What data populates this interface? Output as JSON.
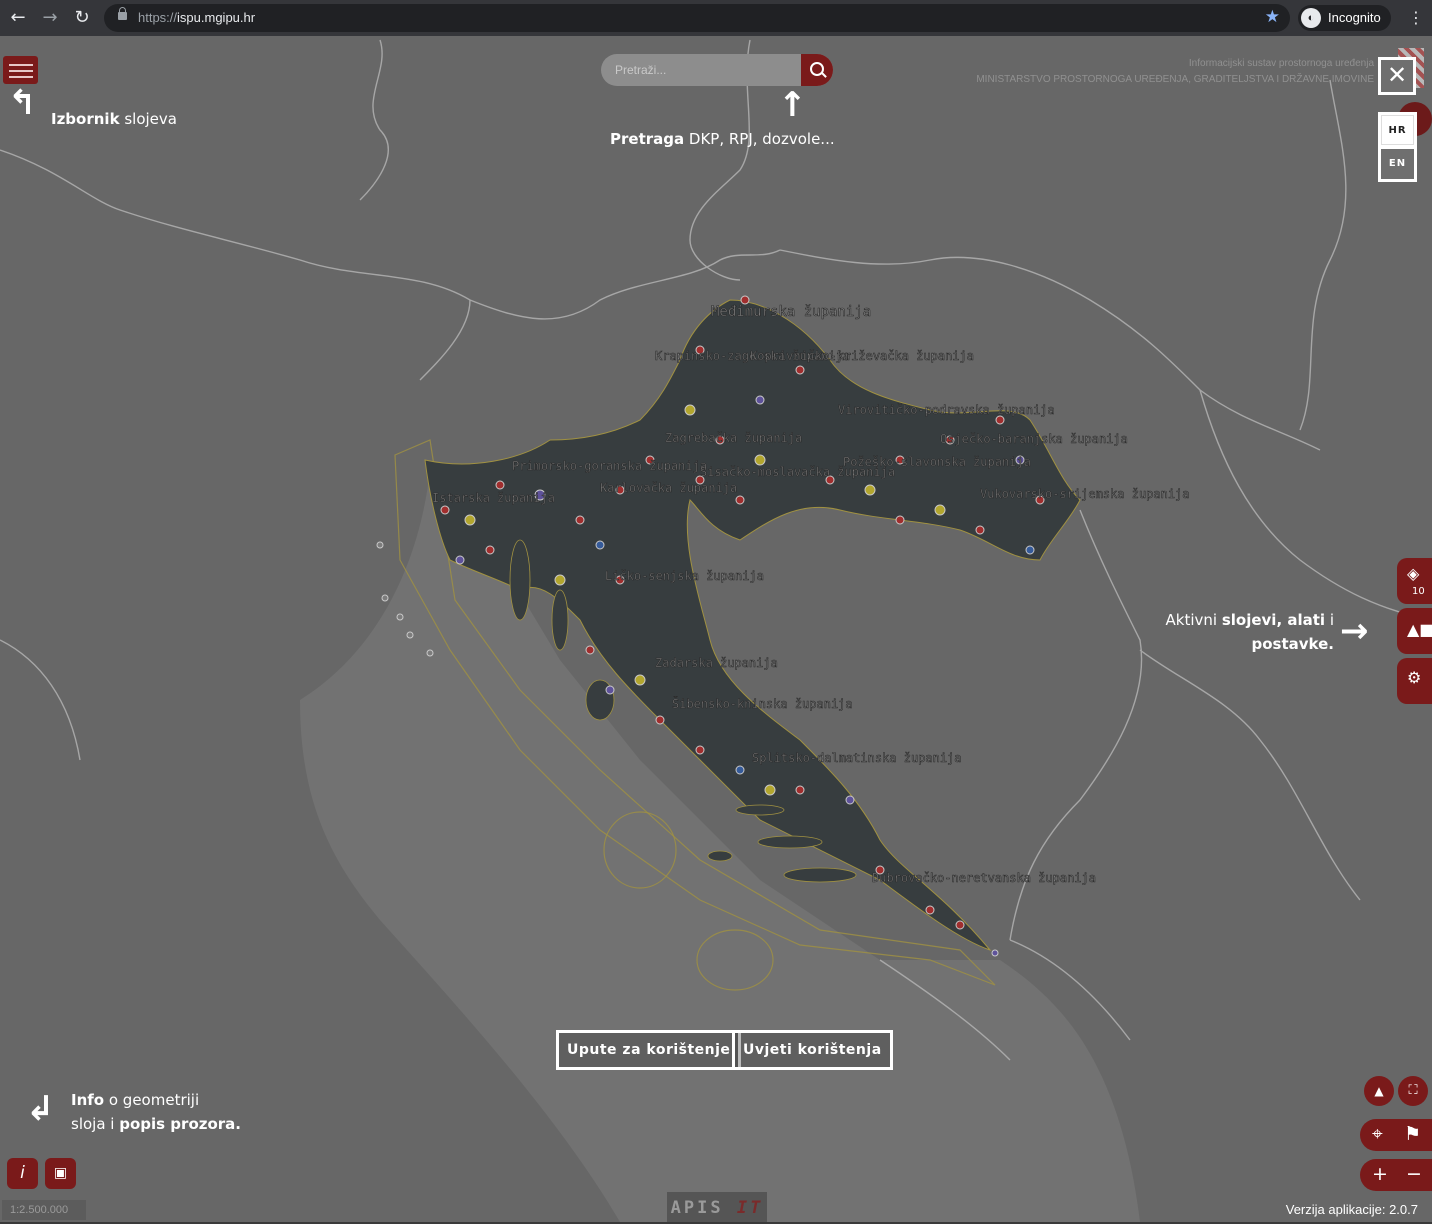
{
  "browser": {
    "url_scheme": "https://",
    "url_host": "ispu.mgipu.hr",
    "profile_label": "Incognito"
  },
  "search": {
    "placeholder": "Pretraži..."
  },
  "banner": {
    "line1": "Informacijski sustav prostornoga uređenja",
    "line2": "MINISTARSTVO PROSTORNOGA UREĐENJA, GRADITELJSTVA I DRŽAVNE IMOVINE"
  },
  "language": {
    "hr": "HR",
    "en": "EN"
  },
  "hints": {
    "layers_bold": "Izbornik",
    "layers_rest": " slojeva",
    "search_bold": "Pretraga",
    "search_rest": " DKP, RPJ, dozvole...",
    "tools_prefix": "Aktivni ",
    "tools_bold": "slojevi, alati",
    "tools_mid": " i",
    "tools_bold2": "postavke.",
    "info_bold": "Info",
    "info_rest": " o geometriji",
    "info_line2_prefix": "sloja i ",
    "info_line2_bold": "popis prozora."
  },
  "side_tabs": {
    "layers_count": "10"
  },
  "map_labels": [
    "Međimurska županija",
    "Krapinsko-zagorska županija",
    "Koprivničko-križevačka županija",
    "Virovitičko-podravska županija",
    "Osječko-baranjska županija",
    "Požeško-slavonska županija",
    "Zagrebačka županija",
    "Sisačko-moslavačka županija",
    "Primorsko-goranska županija",
    "Karlovačka županija",
    "Istarska županija",
    "Ličko-senjska županija",
    "Vukovarsko-srijemska županija",
    "Zadarska županija",
    "Šibensko-kninska županija",
    "Splitsko-dalmatinska županija",
    "Dubrovačko-neretvanska županija"
  ],
  "buttons": {
    "guide": "Upute za korištenje",
    "terms": "Uvjeti korištenja"
  },
  "footer": {
    "scale": "1:2.500.000",
    "logo_a": "APIS",
    "logo_b": "IT",
    "version": "Verzija aplikacije: 2.0.7"
  },
  "colors": {
    "accent": "#7a1a1a",
    "map_bg": "#7d7d7d",
    "croatia": "#3d4447"
  }
}
